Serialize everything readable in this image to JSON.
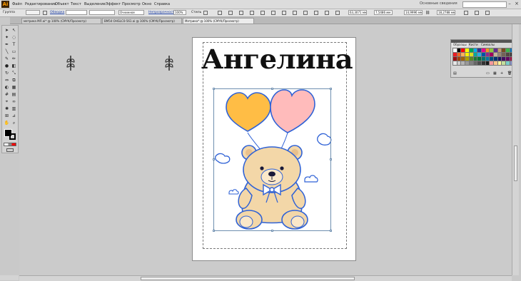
{
  "app": {
    "logo": "Ai"
  },
  "menu": [
    "Файл",
    "Редактирование",
    "Объект",
    "Текст",
    "Выделение",
    "Эффект",
    "Просмотр",
    "Окно",
    "Справка"
  ],
  "workspace": "Основные сведения",
  "control_bar": {
    "selection_label": "Группа",
    "stroke_label": "Обводка",
    "blend_value": "Очнинное",
    "opacity_label": "Непрозрачность",
    "opacity_value": "100%",
    "style_label": "Стиль",
    "x_value": "63,3071 мм",
    "y_value": "7,5486 мм",
    "w_value": "14,9996 мм",
    "h_value": "18,2788 мм"
  },
  "tabs": [
    {
      "label": "метрика МЛ.ai* @ 100% (CMYK/Просмотр)",
      "active": false
    },
    {
      "label": "BM54 OHGLC0-561.ai @ 100% (CMYK/Просмотр)",
      "active": false
    },
    {
      "label": "Метрика* @ 100% (CMYK/Просмотр)",
      "active": true
    }
  ],
  "artboard": {
    "title": "Ангелина"
  },
  "swatches_panel": {
    "tabs": [
      "Образцы",
      "Кисти",
      "Символы"
    ],
    "colors": [
      "#ffffff",
      "#000000",
      "#ff0000",
      "#ffff00",
      "#00a651",
      "#00aeef",
      "#2e3192",
      "#ec008c",
      "#f7941d",
      "#8dc63f",
      "#662d91",
      "#c69c6d",
      "#754c24",
      "#39b54a",
      "#0072bc",
      "#ed1c24",
      "#f26522",
      "#fbaf5d",
      "#fff200",
      "#d7df23",
      "#00a99d",
      "#29abe2",
      "#0054a6",
      "#92278f",
      "#9e005d",
      "#c2b59b",
      "#998675",
      "#736357",
      "#534741",
      "#362f2d",
      "#9e0b0f",
      "#a0410d",
      "#a36209",
      "#aba000",
      "#598527",
      "#1a7b30",
      "#007236",
      "#00746b",
      "#0076a3",
      "#004a80",
      "#003471",
      "#1b1464",
      "#440e62",
      "#630460",
      "#9e0039",
      "#e6e6e6",
      "#cccccc",
      "#b3b3b3",
      "#999999",
      "#808080",
      "#666666",
      "#4d4d4d",
      "#333333",
      "#1a1a1a",
      "#f5989d",
      "#fdc689",
      "#fff799",
      "#c4df9b",
      "#7accc8",
      "#8493ca"
    ]
  },
  "accent": {
    "orange_heart": "#ffbd45",
    "pink_heart": "#ffbbbb",
    "bear": "#f3d7a8",
    "outline": "#2f62d6"
  }
}
